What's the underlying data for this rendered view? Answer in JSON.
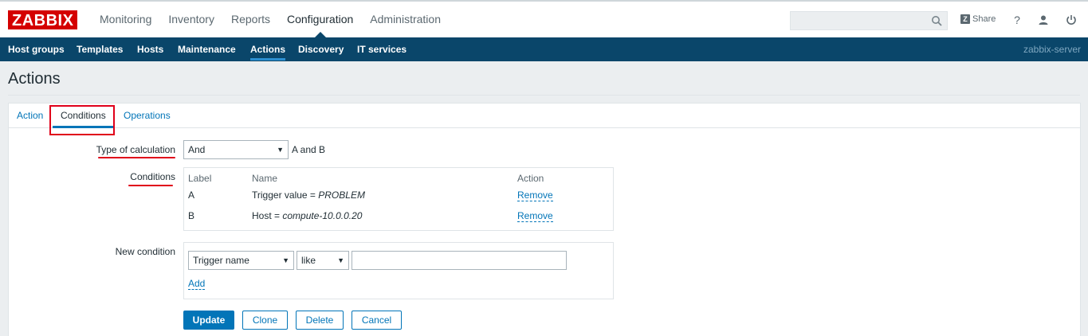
{
  "header": {
    "logo": "ZABBIX",
    "main_nav": [
      "Monitoring",
      "Inventory",
      "Reports",
      "Configuration",
      "Administration"
    ],
    "active_main": "Configuration",
    "share_label": "Share",
    "icons": [
      "search-icon",
      "help-icon",
      "user-icon",
      "logout-icon"
    ]
  },
  "subnav": {
    "items": [
      "Host groups",
      "Templates",
      "Hosts",
      "Maintenance",
      "Actions",
      "Discovery",
      "IT services"
    ],
    "active": "Actions",
    "server": "zabbix-server"
  },
  "page": {
    "title": "Actions"
  },
  "tabs": [
    "Action",
    "Conditions",
    "Operations"
  ],
  "active_tab": "Conditions",
  "form": {
    "type_of_calculation_label": "Type of calculation",
    "calculation_value": "And",
    "calculation_formula": "A and B",
    "conditions_label": "Conditions",
    "conditions_table": {
      "headers": [
        "Label",
        "Name",
        "Action"
      ],
      "rows": [
        {
          "label": "A",
          "name_prefix": "Trigger value = ",
          "name_value": "PROBLEM",
          "action": "Remove"
        },
        {
          "label": "B",
          "name_prefix": "Host = ",
          "name_value": "compute-10.0.0.20",
          "action": "Remove"
        }
      ]
    },
    "new_condition_label": "New condition",
    "new_condition_type": "Trigger name",
    "new_condition_operator": "like",
    "new_condition_value": "",
    "add_label": "Add"
  },
  "buttons": {
    "update": "Update",
    "clone": "Clone",
    "delete": "Delete",
    "cancel": "Cancel"
  },
  "colors": {
    "brand_red": "#d40000",
    "subnav_bg": "#0a466a",
    "link_blue": "#0275b8",
    "annotation_red": "#e0001a"
  }
}
